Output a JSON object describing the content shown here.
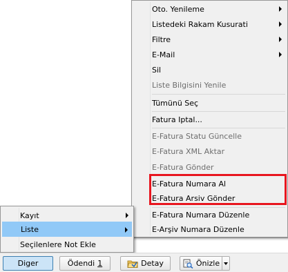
{
  "submenu": {
    "items": [
      {
        "label": "Oto. Yenileme",
        "disabled": false,
        "has_submenu": true
      },
      {
        "label": "Listedeki Rakam Kusurati",
        "disabled": false,
        "has_submenu": true
      },
      {
        "label": "Filtre",
        "disabled": false,
        "has_submenu": true
      },
      {
        "label": "E-Mail",
        "disabled": false,
        "has_submenu": true
      },
      {
        "label": "Sil",
        "disabled": false,
        "has_submenu": false
      },
      {
        "label": "Liste Bilgisini Yenile",
        "disabled": true,
        "has_submenu": false
      },
      {
        "label": "Tümünü Seç",
        "disabled": false,
        "has_submenu": false
      },
      {
        "label": "Fatura Iptal...",
        "disabled": false,
        "has_submenu": false
      },
      {
        "label": "E-Fatura Statu Güncelle",
        "disabled": true,
        "has_submenu": false
      },
      {
        "label": "E-Fatura XML Aktar",
        "disabled": true,
        "has_submenu": false
      },
      {
        "label": "E-Fatura Gönder",
        "disabled": true,
        "has_submenu": false
      },
      {
        "label": "E-Fatura Numara Al",
        "disabled": false,
        "has_submenu": false
      },
      {
        "label": "E-Fatura Arsiv Gönder",
        "disabled": false,
        "has_submenu": false
      },
      {
        "label": "E-Fatura Numara Düzenle",
        "disabled": false,
        "has_submenu": false
      },
      {
        "label": "E-Arşiv Numara Düzenle",
        "disabled": false,
        "has_submenu": false
      }
    ]
  },
  "main_menu": {
    "items": [
      {
        "label": "Kayıt",
        "has_submenu": true,
        "selected": false
      },
      {
        "label": "Liste",
        "has_submenu": true,
        "selected": true
      },
      {
        "label": "Seçilenlere Not Ekle",
        "has_submenu": false,
        "selected": false
      }
    ]
  },
  "toolbar": {
    "diger_label": "Diger",
    "odendi_label": "Ödendi",
    "odendi_number": "1",
    "detay_label": "Detay",
    "onizle_label": "Önizle",
    "detay_icon": "folder-icon",
    "onizle_icon": "print-preview-icon"
  },
  "colors": {
    "highlight_box": "#e8151e",
    "selection": "#91c9f7",
    "menu_bg": "#f0f0f0"
  }
}
